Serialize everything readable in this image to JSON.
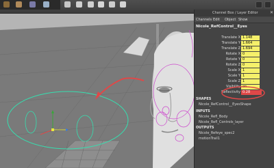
{
  "channel_box": {
    "title": "Channel Box / Layer Editor",
    "close_label": "✕",
    "menu": [
      "Channels",
      "Edit",
      "Object",
      "Show"
    ],
    "object_name": "Nicole_RefControl__Eyes",
    "attributes": [
      {
        "label": "Translate X",
        "value": "1.148",
        "highlight": false
      },
      {
        "label": "Translate Y",
        "value": "1.664",
        "highlight": false
      },
      {
        "label": "Translate Z",
        "value": "1.694",
        "highlight": false
      },
      {
        "label": "Rotate X",
        "value": "0",
        "highlight": false
      },
      {
        "label": "Rotate Y",
        "value": "0",
        "highlight": false
      },
      {
        "label": "Rotate Z",
        "value": "0",
        "highlight": false
      },
      {
        "label": "Scale X",
        "value": "1",
        "highlight": false
      },
      {
        "label": "Scale Y",
        "value": "1",
        "highlight": false
      },
      {
        "label": "Scale Z",
        "value": "1",
        "highlight": false
      },
      {
        "label": "Visibility",
        "value": "on",
        "highlight": false
      },
      {
        "label": "Reflectivity",
        "value": "0.28",
        "highlight": true
      }
    ],
    "shapes_header": "SHAPES",
    "shapes": [
      "Nicole_RefControl__EyesShape"
    ],
    "inputs_header": "INPUTS",
    "inputs": [
      "Nicole_Refl_Body",
      "Nicole_Refl_Controls_layer"
    ],
    "outputs_header": "OUTPUTS",
    "outputs": [
      "Nicole_Refeye_spec2",
      "motionTrail1"
    ]
  },
  "colors": {
    "annotation": "#e04848",
    "control_curve": "#35e0b0",
    "head_wire": "#cc44cc",
    "attr_field": "#f5f06a"
  }
}
